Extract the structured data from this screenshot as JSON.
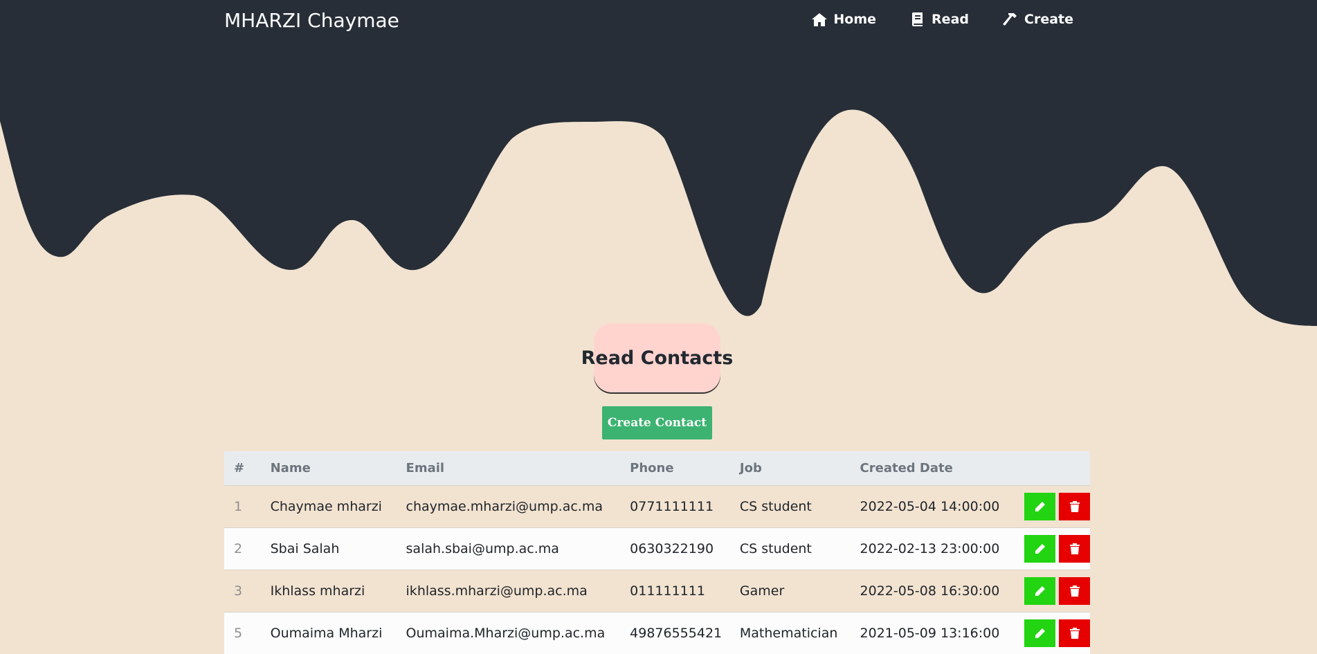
{
  "navbar": {
    "brand": "MHARZI Chaymae",
    "items": [
      {
        "label": "Home",
        "icon": "home-icon"
      },
      {
        "label": "Read",
        "icon": "book-icon"
      },
      {
        "label": "Create",
        "icon": "hammer-icon"
      }
    ]
  },
  "page": {
    "title": "Read Contacts",
    "create_button": "Create Contact"
  },
  "table": {
    "headers": [
      "#",
      "Name",
      "Email",
      "Phone",
      "Job",
      "Created Date"
    ],
    "rows": [
      [
        "1",
        "Chaymae mharzi",
        "chaymae.mharzi@ump.ac.ma",
        "0771111111",
        "CS student",
        "2022-05-04 14:00:00"
      ],
      [
        "2",
        "Sbai Salah",
        "salah.sbai@ump.ac.ma",
        "0630322190",
        "CS student",
        "2022-02-13 23:00:00"
      ],
      [
        "3",
        "Ikhlass mharzi",
        "ikhlass.mharzi@ump.ac.ma",
        "011111111",
        "Gamer",
        "2022-05-08 16:30:00"
      ],
      [
        "5",
        "Oumaima Mharzi",
        "Oumaima.Mharzi@ump.ac.ma",
        "49876555421",
        "Mathematician",
        "2021-05-09 13:16:00"
      ]
    ]
  },
  "colors": {
    "header_bg": "#272e37",
    "page_bg": "#f2e3d1",
    "title_bg": "#ffd4cf",
    "create_button": "#3cb371",
    "edit_button": "#22d411",
    "delete_button": "#e60000"
  }
}
